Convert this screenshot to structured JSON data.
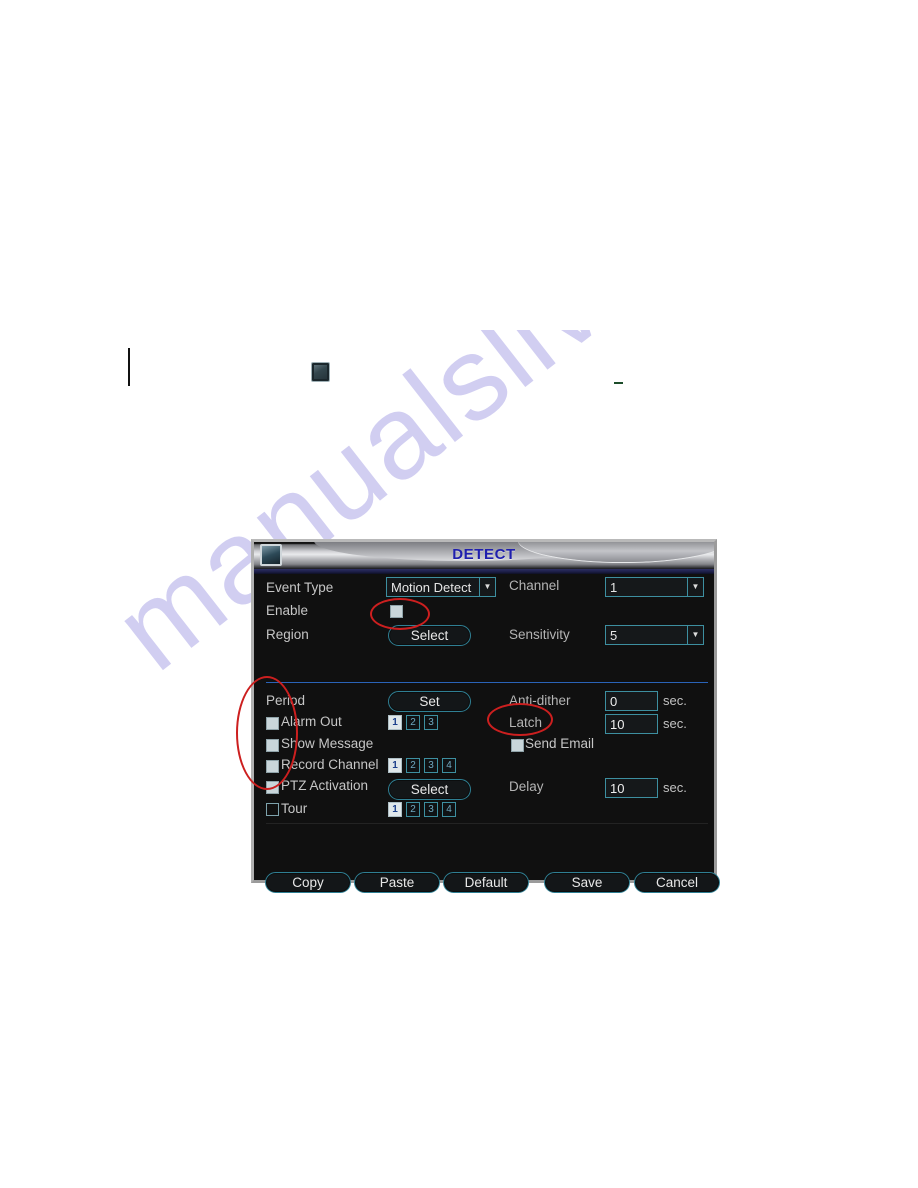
{
  "page": {
    "watermark_text": "manualslive.com",
    "watermark_color": "#c9c6ef",
    "stray_icon": "screen-icon",
    "stray_dash": "dash-mark",
    "vertical_rule": "margin-rule"
  },
  "dialog": {
    "title": "DETECT",
    "title_icon": "camera-icon",
    "title_color": "#1f1fae",
    "accent_color": "#3d8fa0",
    "background_color": "#101010",
    "separator_color": "#2a63b8"
  },
  "form": {
    "event_type": {
      "label": "Event Type",
      "value": "Motion Detect",
      "arrow_icon": "chevron-down-icon"
    },
    "enable": {
      "label": "Enable",
      "checked": true
    },
    "region": {
      "label": "Region",
      "button_label": "Select"
    },
    "channel": {
      "label": "Channel",
      "value": "1",
      "arrow_icon": "chevron-down-icon"
    },
    "sensitivity": {
      "label": "Sensitivity",
      "value": "5",
      "arrow_icon": "chevron-down-icon"
    },
    "period": {
      "label": "Period",
      "button_label": "Set"
    },
    "anti_dither": {
      "label": "Anti-dither",
      "value": "0",
      "unit": "sec."
    },
    "latch": {
      "label": "Latch",
      "value": "10",
      "unit": "sec."
    },
    "alarm_out": {
      "label": "Alarm Out",
      "checked": true,
      "channels": [
        "1",
        "2",
        "3"
      ],
      "active_channels": [
        "1"
      ]
    },
    "show_message": {
      "label": "Show Message",
      "checked": true
    },
    "send_email": {
      "label": "Send Email",
      "checked": true
    },
    "record_channel": {
      "label": "Record Channel",
      "checked": true,
      "channels": [
        "1",
        "2",
        "3",
        "4"
      ],
      "active_channels": [
        "1"
      ]
    },
    "ptz_activation": {
      "label": "PTZ Activation",
      "checked": true,
      "button_label": "Select"
    },
    "delay": {
      "label": "Delay",
      "value": "10",
      "unit": "sec."
    },
    "tour": {
      "label": "Tour",
      "checked": false,
      "channels": [
        "1",
        "2",
        "3",
        "4"
      ],
      "active_channels": [
        "1"
      ]
    }
  },
  "footer": {
    "copy": "Copy",
    "paste": "Paste",
    "default": "Default",
    "save": "Save",
    "cancel": "Cancel"
  },
  "annotations": {
    "color": "#cc1f1f",
    "items": [
      "enable-checkbox-highlight",
      "left-checkbox-group-highlight",
      "send-email-highlight"
    ]
  }
}
